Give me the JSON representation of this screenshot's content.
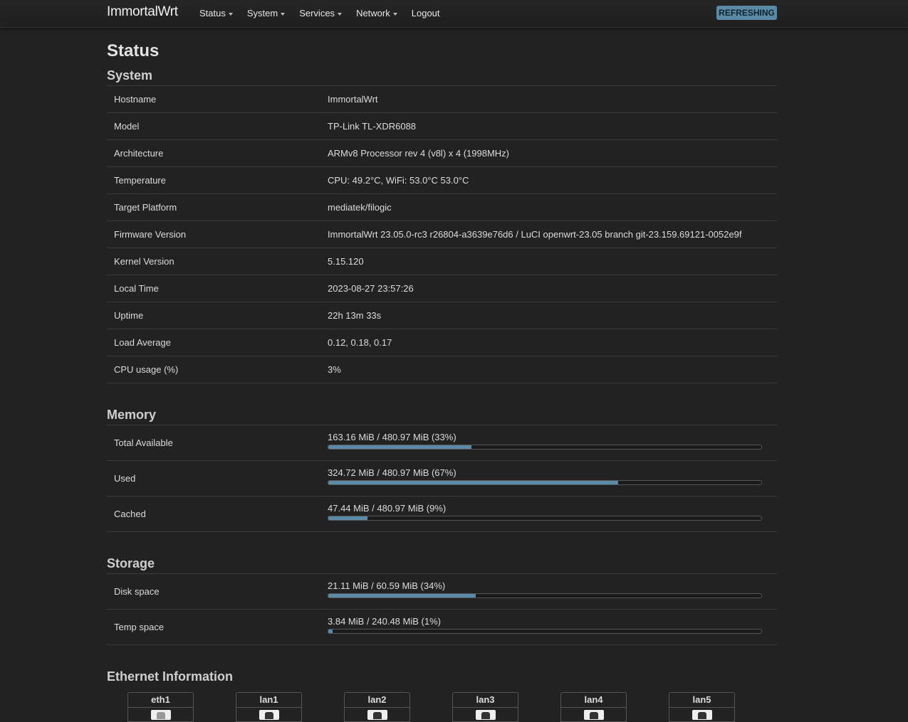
{
  "header": {
    "brand": "ImmortalWrt",
    "nav": [
      {
        "label": "Status",
        "dropdown": true
      },
      {
        "label": "System",
        "dropdown": true
      },
      {
        "label": "Services",
        "dropdown": true
      },
      {
        "label": "Network",
        "dropdown": true
      },
      {
        "label": "Logout",
        "dropdown": false
      }
    ],
    "refresh_label": "REFRESHING"
  },
  "page_title": "Status",
  "system": {
    "title": "System",
    "rows": [
      {
        "label": "Hostname",
        "value": "ImmortalWrt"
      },
      {
        "label": "Model",
        "value": "TP-Link TL-XDR6088"
      },
      {
        "label": "Architecture",
        "value": "ARMv8 Processor rev 4 (v8l) x 4 (1998MHz)"
      },
      {
        "label": "Temperature",
        "value": "CPU: 49.2°C, WiFi: 53.0°C 53.0°C"
      },
      {
        "label": "Target Platform",
        "value": "mediatek/filogic"
      },
      {
        "label": "Firmware Version",
        "value": "ImmortalWrt 23.05.0-rc3 r26804-a3639e76d6 / LuCI openwrt-23.05 branch git-23.159.69121-0052e9f"
      },
      {
        "label": "Kernel Version",
        "value": "5.15.120"
      },
      {
        "label": "Local Time",
        "value": "2023-08-27 23:57:26"
      },
      {
        "label": "Uptime",
        "value": "22h 13m 33s"
      },
      {
        "label": "Load Average",
        "value": "0.12, 0.18, 0.17"
      },
      {
        "label": "CPU usage (%)",
        "value": "3%"
      }
    ]
  },
  "memory": {
    "title": "Memory",
    "rows": [
      {
        "label": "Total Available",
        "text": "163.16 MiB / 480.97 MiB (33%)",
        "percent": 33
      },
      {
        "label": "Used",
        "text": "324.72 MiB / 480.97 MiB (67%)",
        "percent": 67
      },
      {
        "label": "Cached",
        "text": "47.44 MiB / 480.97 MiB (9%)",
        "percent": 9
      }
    ]
  },
  "storage": {
    "title": "Storage",
    "rows": [
      {
        "label": "Disk space",
        "text": "21.11 MiB / 60.59 MiB (34%)",
        "percent": 34
      },
      {
        "label": "Temp space",
        "text": "3.84 MiB / 240.48 MiB (1%)",
        "percent": 1
      }
    ]
  },
  "ethernet": {
    "title": "Ethernet Information",
    "ports": [
      {
        "name": "eth1",
        "connected": false
      },
      {
        "name": "lan1",
        "connected": true
      },
      {
        "name": "lan2",
        "connected": true
      },
      {
        "name": "lan3",
        "connected": true
      },
      {
        "name": "lan4",
        "connected": true
      },
      {
        "name": "lan5",
        "connected": true
      }
    ]
  },
  "colors": {
    "accent": "#5a8aa5",
    "background": "#222222"
  }
}
